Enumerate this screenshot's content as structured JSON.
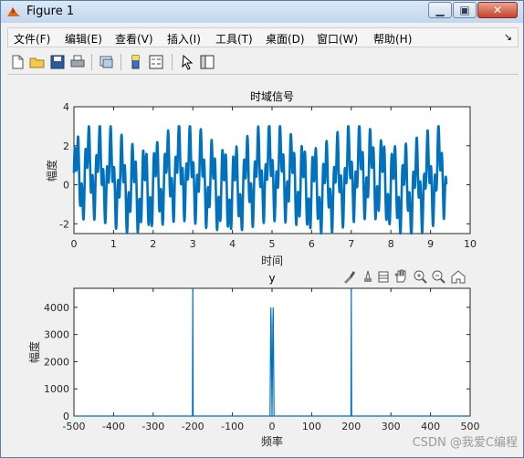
{
  "window": {
    "title": "Figure 1",
    "minimize": "▁",
    "restore": "▣",
    "close": "✕"
  },
  "menu": [
    "文件(F)",
    "编辑(E)",
    "查看(V)",
    "插入(I)",
    "工具(T)",
    "桌面(D)",
    "窗口(W)",
    "帮助(H)"
  ],
  "menu_overflow_icon": "arrow-icon",
  "toolbar_icons": [
    "new-figure-icon",
    "open-file-icon",
    "save-icon",
    "print-icon",
    "link-icon",
    "colorbar-icon",
    "legend-icon",
    "pointer-icon",
    "property-inspector-icon"
  ],
  "axes_toolbar_icons": [
    "brush-icon",
    "data-tip-icon",
    "pan-icon",
    "zoom-in-icon",
    "zoom-out-icon",
    "home-icon"
  ],
  "colors": {
    "line": "#0072bd",
    "axes_bg": "#ffffff",
    "figure_bg": "#f0f0f0"
  },
  "chart_data": [
    {
      "type": "line",
      "title": "时域信号",
      "xlabel": "时间",
      "ylabel": "幅度",
      "xlim": [
        0,
        10
      ],
      "ylim": [
        -2.5,
        4
      ],
      "xticks": [
        0,
        1,
        2,
        3,
        4,
        5,
        6,
        7,
        8,
        9,
        10
      ],
      "yticks": [
        -2,
        0,
        2,
        4
      ],
      "x_end": 9.4,
      "y_range": [
        -2.5,
        3
      ],
      "series": [
        {
          "approx_signal": "sin(2π·10t)·… composite oscillation between -2.5 and 3"
        }
      ]
    },
    {
      "type": "line",
      "title": "y",
      "xlabel": "频率",
      "ylabel": "幅度",
      "xlim": [
        -500,
        500
      ],
      "ylim": [
        0,
        4700
      ],
      "xticks": [
        -500,
        -400,
        -300,
        -200,
        -100,
        0,
        100,
        200,
        300,
        400,
        500
      ],
      "yticks": [
        0,
        1000,
        2000,
        3000,
        4000
      ],
      "series": [
        {
          "x": [
            -500,
            -201,
            -200,
            -199,
            -5,
            -3,
            -2,
            0,
            2,
            3,
            5,
            199,
            200,
            201,
            500
          ],
          "y": [
            0,
            0,
            4700,
            0,
            0,
            4000,
            3400,
            0,
            3400,
            4000,
            0,
            0,
            4700,
            0,
            0
          ]
        }
      ]
    }
  ],
  "watermark": "CSDN @我爱C编程"
}
